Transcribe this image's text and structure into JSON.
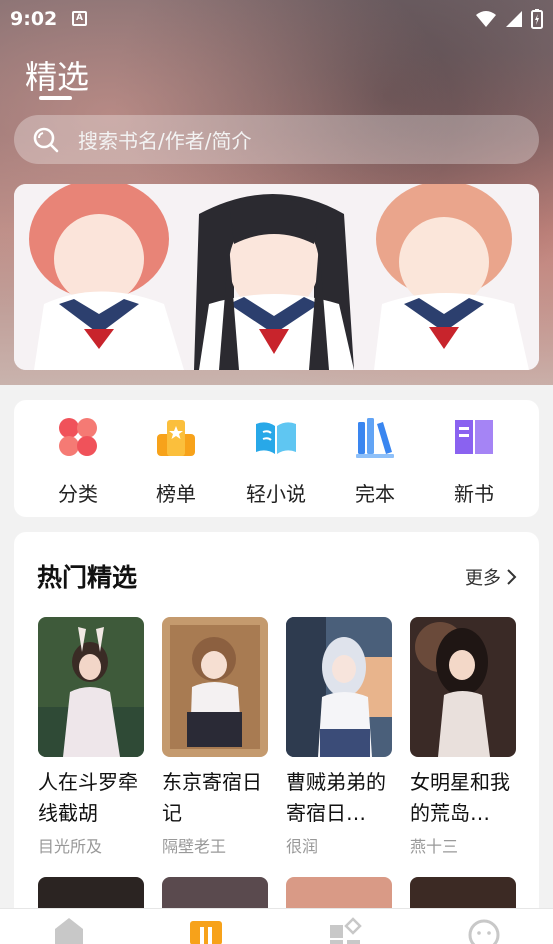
{
  "status": {
    "time": "9:02"
  },
  "header": {
    "title": "精选"
  },
  "search": {
    "placeholder": "搜索书名/作者/简介"
  },
  "categories": [
    {
      "label": "分类",
      "icon": "clover-icon",
      "color": "#f0525a"
    },
    {
      "label": "榜单",
      "icon": "ranking-icon",
      "color": "#f7a21a"
    },
    {
      "label": "轻小说",
      "icon": "open-book-icon",
      "color": "#28a8e8"
    },
    {
      "label": "完本",
      "icon": "books-icon",
      "color": "#3a86f0"
    },
    {
      "label": "新书",
      "icon": "new-book-icon",
      "color": "#8a62f0"
    }
  ],
  "hot": {
    "title": "热门精选",
    "more": "更多",
    "books": [
      {
        "name": "人在斗罗牵线截胡",
        "author": "目光所及"
      },
      {
        "name": "东京寄宿日记",
        "author": "隔壁老王"
      },
      {
        "name": "曹贼弟弟的寄宿日…",
        "author": "很润"
      },
      {
        "name": "女明星和我的荒岛…",
        "author": "燕十三"
      }
    ]
  },
  "tabs": [
    {
      "icon": "home-icon"
    },
    {
      "icon": "bookstore-icon",
      "active_color": "#f7a21a"
    },
    {
      "icon": "category-grid-icon"
    },
    {
      "icon": "profile-icon"
    }
  ]
}
